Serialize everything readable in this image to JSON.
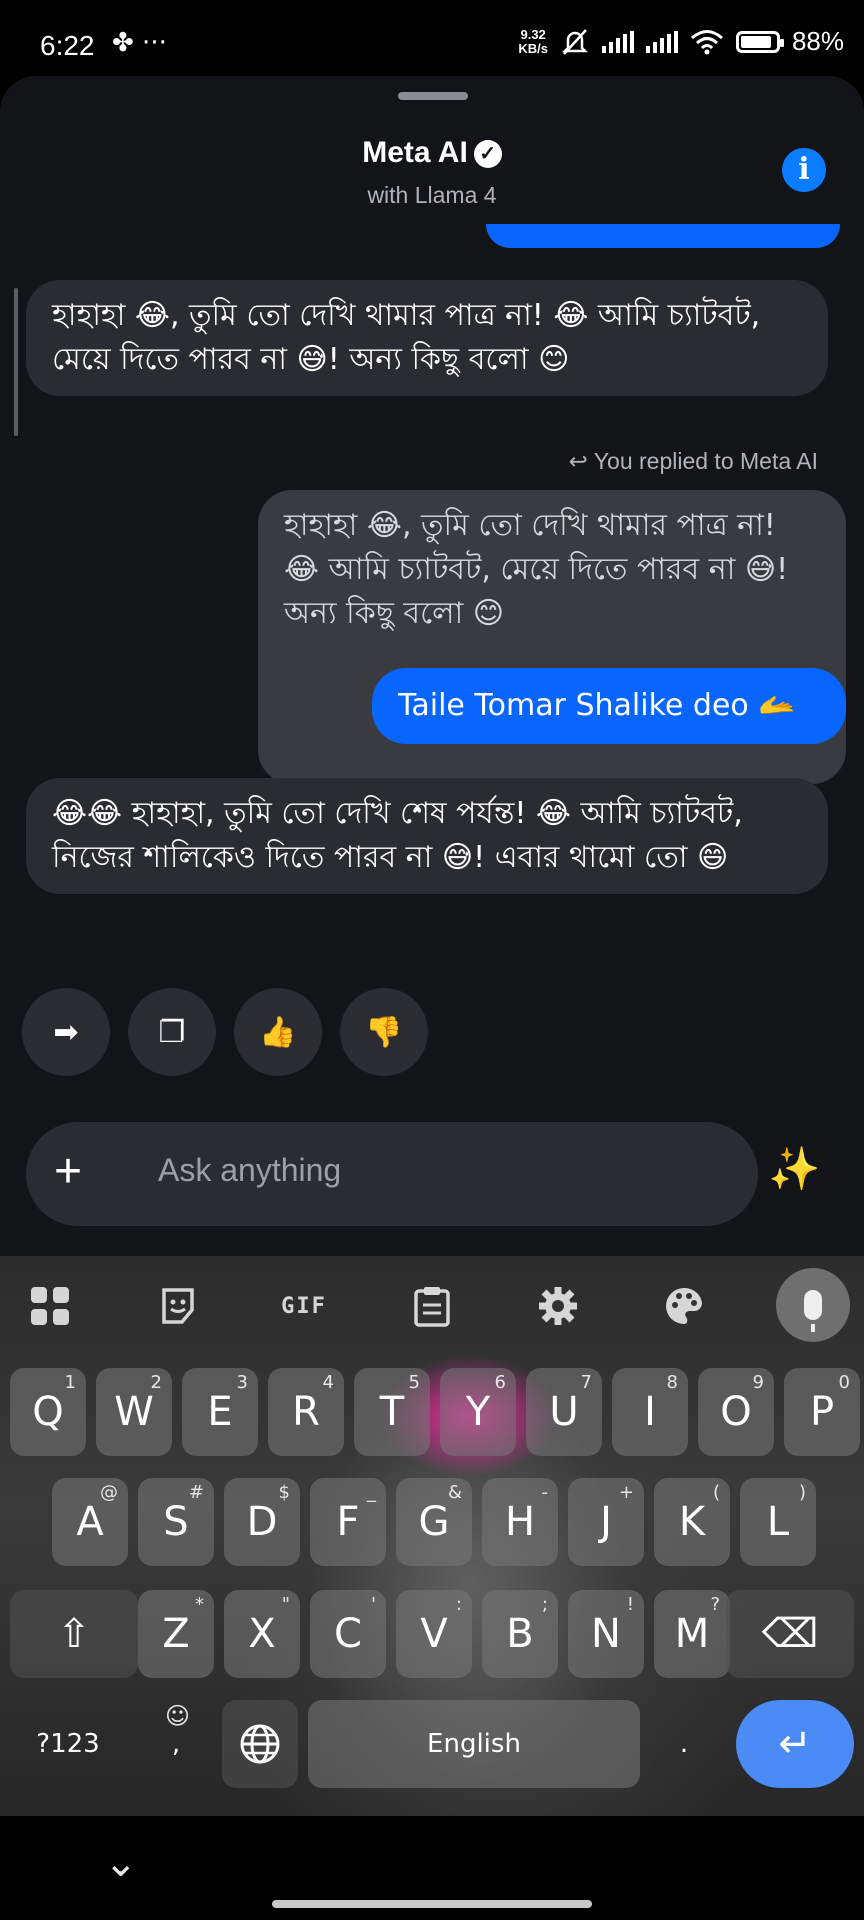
{
  "status_bar": {
    "time": "6:22",
    "extra": "✤ ···",
    "net_speed_value": "9.32",
    "net_speed_unit": "KB/s",
    "battery": "88%",
    "battery_level": 0.88
  },
  "header": {
    "title": "Meta AI",
    "subtitle": "with Llama 4"
  },
  "messages": [
    {
      "role": "ai",
      "text": "হাহাহা 😂, তুমি তো দেখি থামার পাত্র না! 😂 আমি চ্যাটবট, মেয়ে দিতে পারব না 😅! অন্য কিছু বলো 😊"
    },
    {
      "role": "reply_note",
      "text": "You replied to Meta AI"
    },
    {
      "role": "quote",
      "text": "হাহাহা 😂, তুমি তো দেখি থামার পাত্র না! 😂 আমি চ্যাটবট, মেয়ে দিতে পারব না 😅! অন্য কিছু বলো 😊"
    },
    {
      "role": "user",
      "text": "Taile Tomar Shalike deo 🫴"
    },
    {
      "role": "ai",
      "text": "😂😂 হাহাহা, তুমি তো দেখি শেষ পর্যন্ত! 😂 আমি চ্যাটবট, নিজের শালিকেও দিতে পারব না 😅! এবার থামো তো 😄"
    }
  ],
  "actions": {
    "share_icon": "➡",
    "copy_icon": "❐",
    "like_icon": "👍",
    "dislike_icon": "👎"
  },
  "composer": {
    "plus": "+",
    "placeholder": "Ask anything",
    "sparkle": "✨"
  },
  "keyboard": {
    "toolbar": {
      "gif": "GIF"
    },
    "row1": [
      {
        "k": "Q",
        "h": "1"
      },
      {
        "k": "W",
        "h": "2"
      },
      {
        "k": "E",
        "h": "3"
      },
      {
        "k": "R",
        "h": "4"
      },
      {
        "k": "T",
        "h": "5"
      },
      {
        "k": "Y",
        "h": "6"
      },
      {
        "k": "U",
        "h": "7"
      },
      {
        "k": "I",
        "h": "8"
      },
      {
        "k": "O",
        "h": "9"
      },
      {
        "k": "P",
        "h": "0"
      }
    ],
    "row2": [
      {
        "k": "A",
        "h": "@"
      },
      {
        "k": "S",
        "h": "#"
      },
      {
        "k": "D",
        "h": "$"
      },
      {
        "k": "F",
        "h": "_"
      },
      {
        "k": "G",
        "h": "&"
      },
      {
        "k": "H",
        "h": "-"
      },
      {
        "k": "J",
        "h": "+"
      },
      {
        "k": "K",
        "h": "("
      },
      {
        "k": "L",
        "h": ")"
      }
    ],
    "row3": [
      {
        "k": "Z",
        "h": "*"
      },
      {
        "k": "X",
        "h": "\""
      },
      {
        "k": "C",
        "h": "'"
      },
      {
        "k": "V",
        "h": ":"
      },
      {
        "k": "B",
        "h": ";"
      },
      {
        "k": "N",
        "h": "!"
      },
      {
        "k": "M",
        "h": "?"
      }
    ],
    "symbols": "?123",
    "emoji_comma": ",",
    "space": "English",
    "period": ".",
    "enter": "↵",
    "backspace": "⌫",
    "shift": "⇧"
  },
  "nav": {
    "down": "⌄"
  }
}
